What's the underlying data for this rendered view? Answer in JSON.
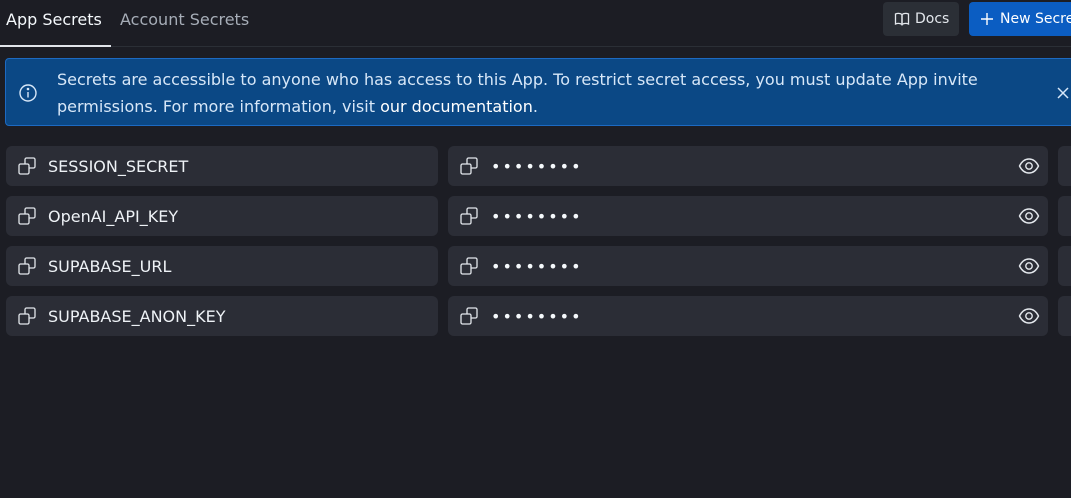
{
  "tabs": {
    "app_secrets": "App Secrets",
    "account_secrets": "Account Secrets"
  },
  "toolbar": {
    "docs_label": "Docs",
    "new_secret_label": "New Secret"
  },
  "banner": {
    "text": "Secrets are accessible to anyone who has access to this App. To restrict secret access, you must update App invite permissions. For more information, visit ",
    "link": "our documentation",
    "suffix": "."
  },
  "secrets": [
    {
      "key": "SESSION_SECRET",
      "value_masked": "••••••••"
    },
    {
      "key": "OpenAI_API_KEY",
      "value_masked": "••••••••"
    },
    {
      "key": "SUPABASE_URL",
      "value_masked": "••••••••"
    },
    {
      "key": "SUPABASE_ANON_KEY",
      "value_masked": "••••••••"
    }
  ],
  "icons": {
    "info": "info-icon",
    "close": "close-icon",
    "copy": "copy-icon",
    "eye": "eye-icon",
    "book": "book-icon",
    "plus": "plus-icon"
  },
  "colors": {
    "background": "#1c1d24",
    "row_background": "#2b2d36",
    "primary_button": "#0b5dc2",
    "banner_background": "#0b4885"
  }
}
